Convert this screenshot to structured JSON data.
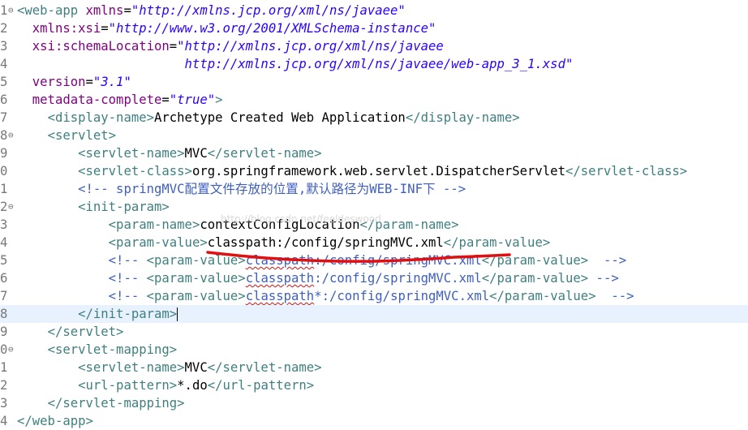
{
  "lines": [
    {
      "num": "1",
      "fold": "⊖",
      "parts": [
        {
          "t": "<web-app",
          "c": "tag"
        },
        {
          "t": " ",
          "c": ""
        },
        {
          "t": "xmlns",
          "c": "attr"
        },
        {
          "t": "=",
          "c": ""
        },
        {
          "t": "\"http://xmlns.jcp.org/xml/ns/javaee\"",
          "c": "val"
        }
      ]
    },
    {
      "num": "2",
      "fold": "",
      "parts": [
        {
          "t": "  ",
          "c": ""
        },
        {
          "t": "xmlns:xsi",
          "c": "attr"
        },
        {
          "t": "=",
          "c": ""
        },
        {
          "t": "\"http://www.w3.org/2001/XMLSchema-instance\"",
          "c": "val"
        }
      ]
    },
    {
      "num": "3",
      "fold": "",
      "parts": [
        {
          "t": "  ",
          "c": ""
        },
        {
          "t": "xsi:schemaLocation",
          "c": "attr"
        },
        {
          "t": "=",
          "c": ""
        },
        {
          "t": "\"http://xmlns.jcp.org/xml/ns/javaee",
          "c": "val"
        }
      ]
    },
    {
      "num": "4",
      "fold": "",
      "parts": [
        {
          "t": "                      ",
          "c": ""
        },
        {
          "t": "http://xmlns.jcp.org/xml/ns/javaee/web-app_3_1.xsd\"",
          "c": "val"
        }
      ]
    },
    {
      "num": "5",
      "fold": "",
      "parts": [
        {
          "t": "  ",
          "c": ""
        },
        {
          "t": "version",
          "c": "attr"
        },
        {
          "t": "=",
          "c": ""
        },
        {
          "t": "\"3.1\"",
          "c": "val"
        }
      ]
    },
    {
      "num": "6",
      "fold": "",
      "parts": [
        {
          "t": "  ",
          "c": ""
        },
        {
          "t": "metadata-complete",
          "c": "attr"
        },
        {
          "t": "=",
          "c": ""
        },
        {
          "t": "\"true\"",
          "c": "val"
        },
        {
          "t": ">",
          "c": "tag"
        }
      ]
    },
    {
      "num": "7",
      "fold": "",
      "parts": [
        {
          "t": "    ",
          "c": ""
        },
        {
          "t": "<display-name>",
          "c": "tag"
        },
        {
          "t": "Archetype Created Web Application",
          "c": ""
        },
        {
          "t": "</display-name>",
          "c": "tag"
        }
      ]
    },
    {
      "num": "8",
      "fold": "⊖",
      "parts": [
        {
          "t": "    ",
          "c": ""
        },
        {
          "t": "<servlet>",
          "c": "tag"
        }
      ]
    },
    {
      "num": "9",
      "fold": "",
      "parts": [
        {
          "t": "        ",
          "c": ""
        },
        {
          "t": "<servlet-name>",
          "c": "tag"
        },
        {
          "t": "MVC",
          "c": ""
        },
        {
          "t": "</servlet-name>",
          "c": "tag"
        }
      ]
    },
    {
      "num": "0",
      "fold": "",
      "parts": [
        {
          "t": "        ",
          "c": ""
        },
        {
          "t": "<servlet-class>",
          "c": "tag"
        },
        {
          "t": "org.springframework.web.servlet.DispatcherServlet",
          "c": ""
        },
        {
          "t": "</servlet-class>",
          "c": "tag"
        }
      ]
    },
    {
      "num": "1",
      "fold": "",
      "parts": [
        {
          "t": "        ",
          "c": ""
        },
        {
          "t": "<!-- springMVC配置文件存放的位置,默认路径为WEB-INF下 -->",
          "c": "cmt"
        }
      ]
    },
    {
      "num": "2",
      "fold": "⊖",
      "parts": [
        {
          "t": "        ",
          "c": ""
        },
        {
          "t": "<init-param>",
          "c": "tag"
        }
      ]
    },
    {
      "num": "3",
      "fold": "",
      "parts": [
        {
          "t": "            ",
          "c": ""
        },
        {
          "t": "<param-name>",
          "c": "tag"
        },
        {
          "t": "contextConfigLocation",
          "c": ""
        },
        {
          "t": "</param-name>",
          "c": "tag"
        }
      ]
    },
    {
      "num": "4",
      "fold": "",
      "parts": [
        {
          "t": "            ",
          "c": ""
        },
        {
          "t": "<param-value>",
          "c": "tag"
        },
        {
          "t": "classpath:/config/springMVC.xml",
          "c": ""
        },
        {
          "t": "</param-value>",
          "c": "tag"
        }
      ]
    },
    {
      "num": "5",
      "fold": "",
      "parts": [
        {
          "t": "            ",
          "c": ""
        },
        {
          "t": "<!-- ",
          "c": "cmt"
        },
        {
          "t": "<param-value>",
          "c": "tag"
        },
        {
          "t": "classpath",
          "c": "cmt squig"
        },
        {
          "t": ":/config/springMVC.xml",
          "c": "cmt"
        },
        {
          "t": "</param-value>",
          "c": "tag"
        },
        {
          "t": "  -->",
          "c": "cmt"
        }
      ]
    },
    {
      "num": "6",
      "fold": "",
      "parts": [
        {
          "t": "            ",
          "c": ""
        },
        {
          "t": "<!-- ",
          "c": "cmt"
        },
        {
          "t": "<param-value>",
          "c": "tag"
        },
        {
          "t": "classpath",
          "c": "cmt squig"
        },
        {
          "t": ":/config/springMVC.xml",
          "c": "cmt"
        },
        {
          "t": "</param-value>",
          "c": "tag"
        },
        {
          "t": " -->",
          "c": "cmt"
        }
      ]
    },
    {
      "num": "7",
      "fold": "",
      "parts": [
        {
          "t": "            ",
          "c": ""
        },
        {
          "t": "<!-- ",
          "c": "cmt"
        },
        {
          "t": "<param-value>",
          "c": "tag"
        },
        {
          "t": "classpath",
          "c": "cmt squig"
        },
        {
          "t": "*:/config/springMVC.xml",
          "c": "cmt"
        },
        {
          "t": "</param-value>",
          "c": "tag"
        },
        {
          "t": "  -->",
          "c": "cmt"
        }
      ]
    },
    {
      "num": "8",
      "fold": "",
      "current": true,
      "parts": [
        {
          "t": "        ",
          "c": ""
        },
        {
          "t": "</init-param>",
          "c": "tag"
        }
      ]
    },
    {
      "num": "9",
      "fold": "",
      "parts": [
        {
          "t": "    ",
          "c": ""
        },
        {
          "t": "</servlet>",
          "c": "tag"
        }
      ]
    },
    {
      "num": "0",
      "fold": "⊖",
      "parts": [
        {
          "t": "    ",
          "c": ""
        },
        {
          "t": "<servlet-mapping>",
          "c": "tag"
        }
      ]
    },
    {
      "num": "1",
      "fold": "",
      "parts": [
        {
          "t": "        ",
          "c": ""
        },
        {
          "t": "<servlet-name>",
          "c": "tag"
        },
        {
          "t": "MVC",
          "c": ""
        },
        {
          "t": "</servlet-name>",
          "c": "tag"
        }
      ]
    },
    {
      "num": "2",
      "fold": "",
      "parts": [
        {
          "t": "        ",
          "c": ""
        },
        {
          "t": "<url-pattern>",
          "c": "tag"
        },
        {
          "t": "*.do",
          "c": ""
        },
        {
          "t": "</url-pattern>",
          "c": "tag"
        }
      ]
    },
    {
      "num": "3",
      "fold": "",
      "parts": [
        {
          "t": "    ",
          "c": ""
        },
        {
          "t": "</servlet-mapping>",
          "c": "tag"
        }
      ]
    },
    {
      "num": "4",
      "fold": "",
      "parts": [
        {
          "t": "</web-app>",
          "c": "tag"
        }
      ]
    }
  ],
  "watermark": "http://blog.csdn.net/feeldeswood",
  "colors": {
    "tag": "#3f7f7f",
    "attribute": "#7f007f",
    "value": "#2a00ff",
    "comment": "#3f5fbf",
    "current_line": "#e8f2fe",
    "annotation_stroke": "#e01010"
  }
}
